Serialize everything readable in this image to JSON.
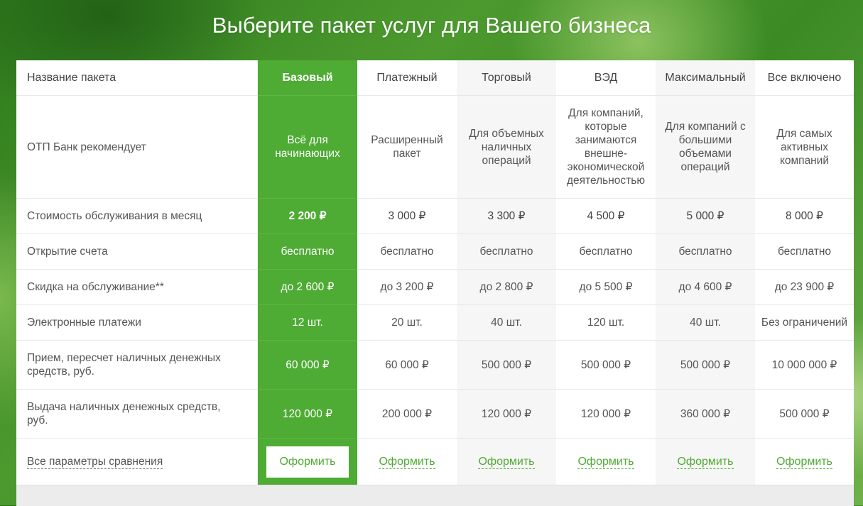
{
  "page": {
    "title": "Выберите пакет услуг для Вашего бизнеса"
  },
  "table": {
    "header_label": "Название пакета",
    "packages": [
      "Базовый",
      "Платежный",
      "Торговый",
      "ВЭД",
      "Максимальный",
      "Все включено"
    ],
    "rows": [
      {
        "label": "ОТП Банк рекомендует",
        "values": [
          "Всё для начинающих",
          "Расширенный пакет",
          "Для объемных наличных операций",
          "Для компаний, которые занимаются внешне-экономической деятельностью",
          "Для компаний с большими объемами операций",
          "Для самых активных компаний"
        ]
      },
      {
        "label": "Стоимость обслуживания в месяц",
        "values": [
          "2 200 ₽",
          "3 000 ₽",
          "3 300 ₽",
          "4 500 ₽",
          "5 000 ₽",
          "8 000 ₽"
        ]
      },
      {
        "label": "Открытие счета",
        "values": [
          "бесплатно",
          "бесплатно",
          "бесплатно",
          "бесплатно",
          "бесплатно",
          "бесплатно"
        ]
      },
      {
        "label": "Скидка на обслуживание**",
        "values": [
          "до 2 600 ₽",
          "до 3 200 ₽",
          "до 2 800 ₽",
          "до 5 500 ₽",
          "до 4 600 ₽",
          "до 23 900 ₽"
        ]
      },
      {
        "label": "Электронные платежи",
        "values": [
          "12 шт.",
          "20 шт.",
          "40 шт.",
          "120 шт.",
          "40 шт.",
          "Без ограничений"
        ]
      },
      {
        "label": "Прием, пересчет наличных денежных средств, руб.",
        "values": [
          "60 000 ₽",
          "60 000 ₽",
          "500 000 ₽",
          "500 000 ₽",
          "500 000 ₽",
          "10 000 000 ₽"
        ]
      },
      {
        "label": "Выдача наличных денежных средств, руб.",
        "values": [
          "120 000 ₽",
          "200 000 ₽",
          "120 000 ₽",
          "120 000 ₽",
          "360 000 ₽",
          "500 000 ₽"
        ]
      }
    ],
    "footer": {
      "all_params_label": "Все параметры сравнения",
      "cta_label": "Оформить"
    }
  },
  "colors": {
    "accent_green": "#4eab33",
    "shade_column": "#f6f6f6"
  }
}
